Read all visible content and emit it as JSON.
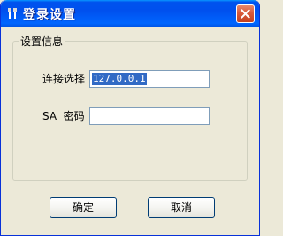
{
  "window": {
    "title": "登录设置",
    "app_icon": "app-icon",
    "close_icon": "close-icon"
  },
  "group": {
    "title": "设置信息"
  },
  "fields": {
    "connect_label": "连接选择",
    "connect_value": "127.0.0.1",
    "sa_label": "SA  密码",
    "sa_password_value": ""
  },
  "buttons": {
    "ok_label": "确定",
    "cancel_label": "取消"
  },
  "colors": {
    "titlebar": "#0055e5",
    "dialog_bg": "#ece9d8",
    "close_button": "#d85a3b",
    "selection": "#316ac5"
  }
}
